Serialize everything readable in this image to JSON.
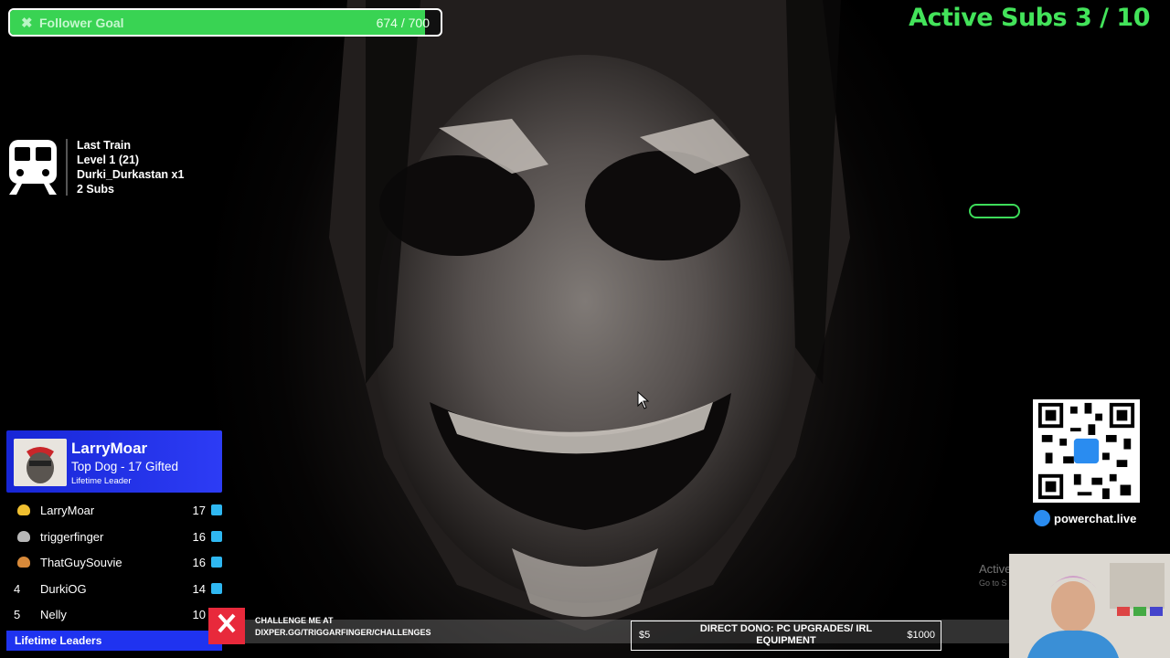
{
  "follower_goal": {
    "label": "Follower Goal",
    "count": "674 / 700",
    "progress": 0.963,
    "icon": "x-icon"
  },
  "active_subs": {
    "text": "Active Subs 3 / 10"
  },
  "last_train": {
    "lines": [
      "Last Train",
      "Level 1 (21)",
      "Durki_Durkastan x1",
      "2 Subs"
    ],
    "icon": "train-icon"
  },
  "leader_card": {
    "name": "LarryMoar",
    "subtitle": "Top Dog - 17 Gifted",
    "tag": "Lifetime Leader"
  },
  "leaders": [
    {
      "rank": "",
      "medal": "#f0c030",
      "name": "LarryMoar",
      "count": "17"
    },
    {
      "rank": "",
      "medal": "#b8b8b8",
      "name": "triggerfinger",
      "count": "16"
    },
    {
      "rank": "",
      "medal": "#d88a3a",
      "name": "ThatGuySouvie",
      "count": "16"
    },
    {
      "rank": "4",
      "medal": "",
      "name": "DurkiOG",
      "count": "14"
    },
    {
      "rank": "5",
      "medal": "",
      "name": "Nelly",
      "count": "10"
    }
  ],
  "lifetime_footer": "Lifetime Leaders",
  "challenge": {
    "line1": "CHALLENGE ME AT",
    "line2": "DIXPER.GG/TRIGGARFINGER/CHALLENGES"
  },
  "dono": {
    "min": "$5",
    "title": "DIRECT DONO: PC UPGRADES/ IRL EQUIPMENT",
    "max": "$1000"
  },
  "powerchat": "powerchat.live",
  "windows_watermark": {
    "title": "Active",
    "sub": "Go to S"
  },
  "colors": {
    "goal_green": "#39d353",
    "subs_green": "#43e35a",
    "leader_blue": "#1f33f0"
  }
}
